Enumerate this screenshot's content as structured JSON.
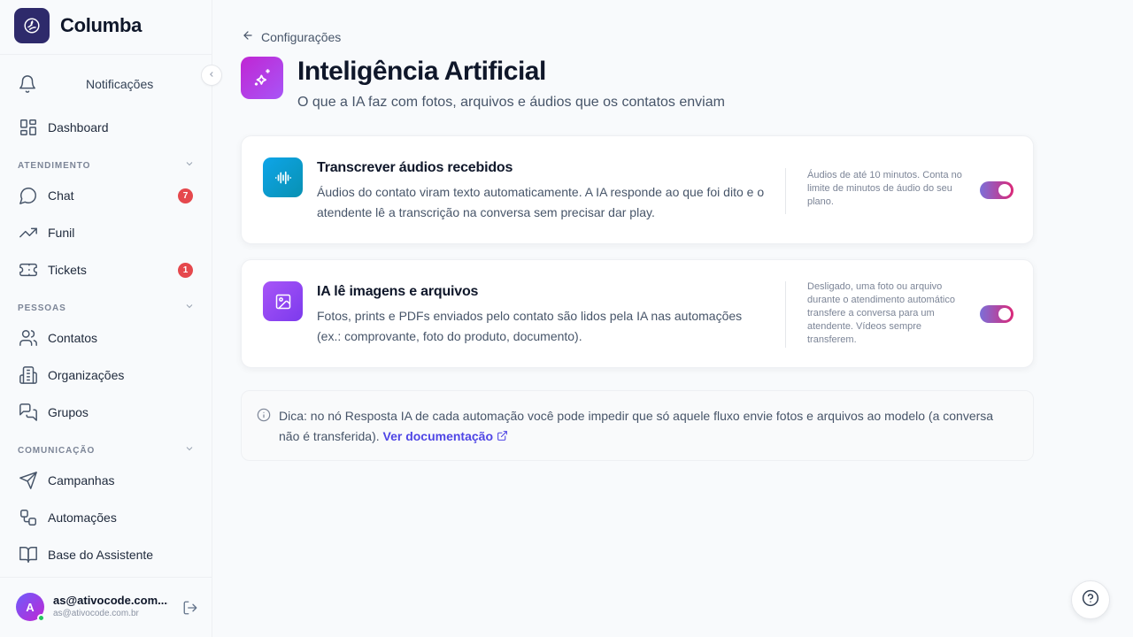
{
  "brand": {
    "name": "Columba"
  },
  "sidebar": {
    "notifications_label": "Notificações",
    "dashboard_label": "Dashboard",
    "sections": [
      {
        "label": "ATENDIMENTO",
        "items": [
          {
            "label": "Chat",
            "badge": "7"
          },
          {
            "label": "Funil"
          },
          {
            "label": "Tickets",
            "badge": "1"
          }
        ]
      },
      {
        "label": "PESSOAS",
        "items": [
          {
            "label": "Contatos"
          },
          {
            "label": "Organizações"
          },
          {
            "label": "Grupos"
          }
        ]
      },
      {
        "label": "COMUNICAÇÃO",
        "items": [
          {
            "label": "Campanhas"
          },
          {
            "label": "Automações"
          },
          {
            "label": "Base do Assistente"
          }
        ]
      }
    ]
  },
  "user": {
    "initial": "A",
    "name": "as@ativocode.com....",
    "email": "as@ativocode.com.br"
  },
  "page": {
    "back_label": "Configurações",
    "title": "Inteligência Artificial",
    "subtitle": "O que a IA faz com fotos, arquivos e áudios que os contatos enviam"
  },
  "cards": [
    {
      "title": "Transcrever áudios recebidos",
      "description": "Áudios do contato viram texto automaticamente. A IA responde ao que foi dito e o atendente lê a transcrição na conversa sem precisar dar play.",
      "note": "Áudios de até 10 minutos. Conta no limite de minutos de áudio do seu plano.",
      "enabled": true
    },
    {
      "title": "IA lê imagens e arquivos",
      "description": "Fotos, prints e PDFs enviados pelo contato são lidos pela IA nas automações (ex.: comprovante, foto do produto, documento).",
      "note": "Desligado, uma foto ou arquivo durante o atendimento automático transfere a conversa para um atendente. Vídeos sempre transferem.",
      "enabled": true
    }
  ],
  "tip": {
    "text": "Dica: no nó Resposta IA de cada automação você pode impedir que só aquele fluxo envie fotos e arquivos ao modelo (a conversa não é transferida). ",
    "link_label": "Ver documentação"
  },
  "colors": {
    "accent": "#4f46e5",
    "badge": "#e5484d",
    "brand_logo": "#2e2a6b",
    "audio_icon": "#0ea5e9",
    "image_icon": "#8b5cf6"
  },
  "icons": {
    "help": "question-circle-icon",
    "info": "info-icon",
    "external": "external-link-icon"
  }
}
